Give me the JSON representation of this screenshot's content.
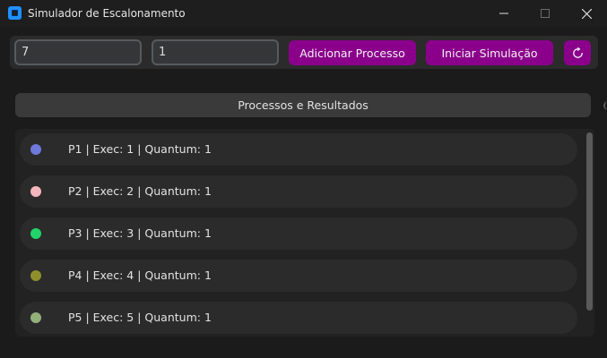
{
  "window": {
    "title": "Simulador de Escalonamento"
  },
  "controls": {
    "entry_exec_value": "7",
    "entry_quantum_value": "1",
    "add_label": "Adicionar Processo",
    "start_label": "Iniciar Simulação",
    "reset_icon": "refresh-icon",
    "button_color": "#8b008b"
  },
  "section": {
    "header": "Processos e Resultados"
  },
  "processes": [
    {
      "label": "P1 | Exec: 1 | Quantum: 1",
      "color": "#6f79d9"
    },
    {
      "label": "P2 | Exec: 2 | Quantum: 1",
      "color": "#f4b6bd"
    },
    {
      "label": "P3 | Exec: 3 | Quantum: 1",
      "color": "#22d36a"
    },
    {
      "label": "P4 | Exec: 4 | Quantum: 1",
      "color": "#8f8f2e"
    },
    {
      "label": "P5 | Exec: 5 | Quantum: 1",
      "color": "#93b07a"
    }
  ]
}
